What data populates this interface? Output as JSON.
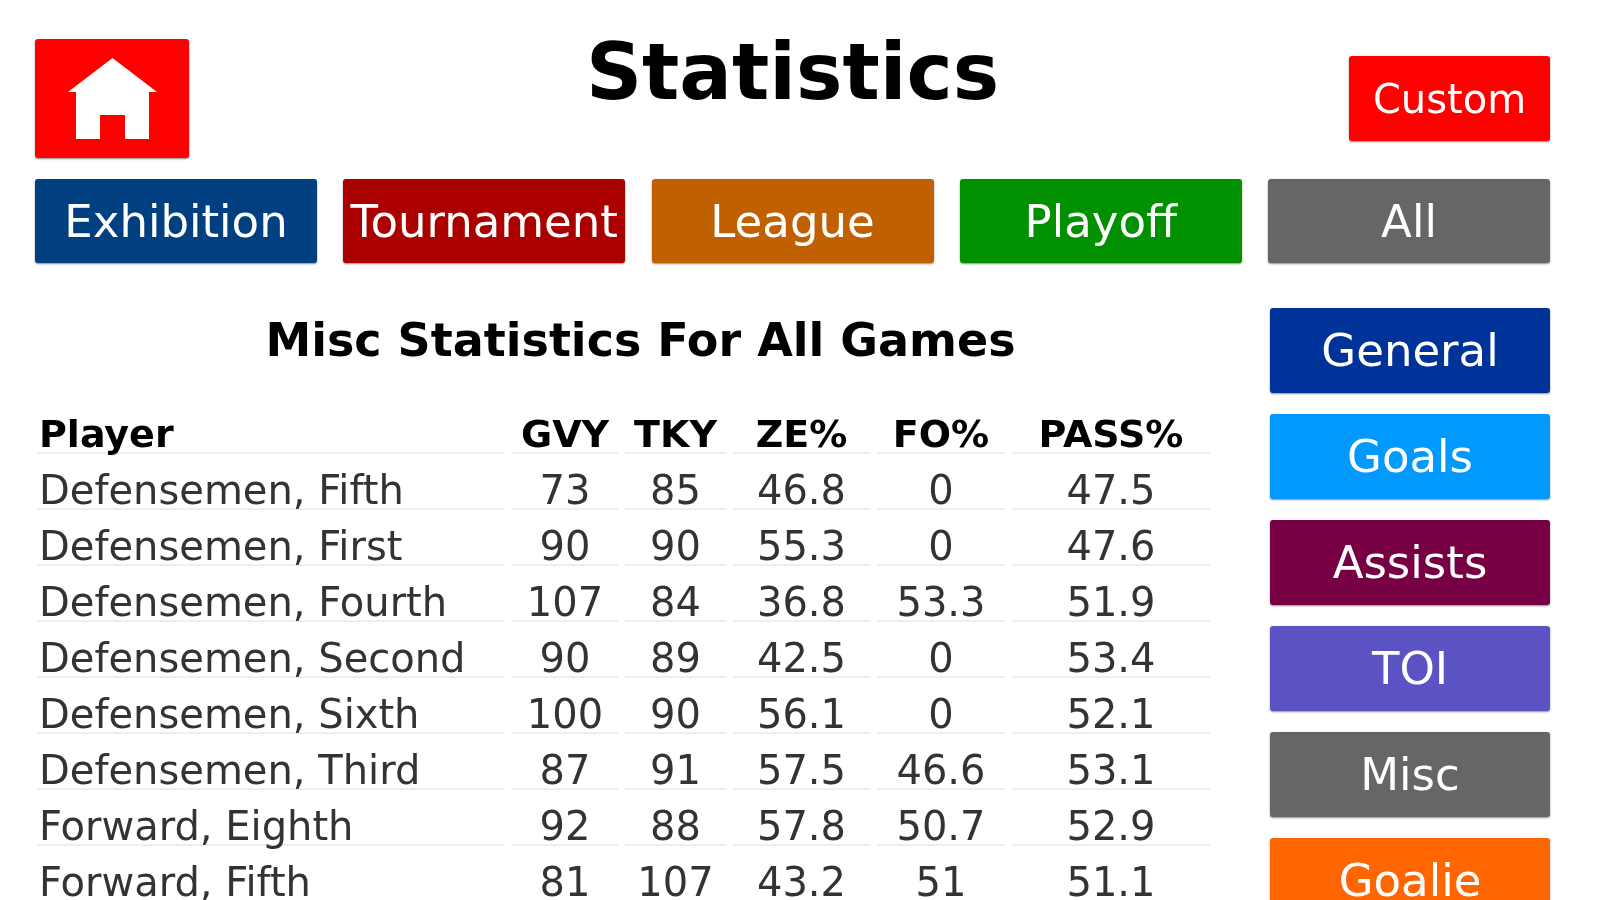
{
  "title": "Statistics",
  "custom_button": {
    "label": "Custom"
  },
  "game_types": [
    {
      "label": "Exhibition",
      "color": "#004080",
      "selected": false
    },
    {
      "label": "Tournament",
      "color": "#aa0000",
      "selected": false
    },
    {
      "label": "League",
      "color": "#c06000",
      "selected": false
    },
    {
      "label": "Playoff",
      "color": "#009000",
      "selected": false
    },
    {
      "label": "All",
      "selected": true
    }
  ],
  "subtitle": "Misc Statistics For All Games",
  "table": {
    "columns": [
      "Player",
      "GVY",
      "TKY",
      "ZE%",
      "FO%",
      "PASS%"
    ],
    "rows": [
      [
        "Defensemen, Fifth",
        "73",
        "85",
        "46.8",
        "0",
        "47.5"
      ],
      [
        "Defensemen, First",
        "90",
        "90",
        "55.3",
        "0",
        "47.6"
      ],
      [
        "Defensemen, Fourth",
        "107",
        "84",
        "36.8",
        "53.3",
        "51.9"
      ],
      [
        "Defensemen, Second",
        "90",
        "89",
        "42.5",
        "0",
        "53.4"
      ],
      [
        "Defensemen, Sixth",
        "100",
        "90",
        "56.1",
        "0",
        "52.1"
      ],
      [
        "Defensemen, Third",
        "87",
        "91",
        "57.5",
        "46.6",
        "53.1"
      ],
      [
        "Forward, Eighth",
        "92",
        "88",
        "57.8",
        "50.7",
        "52.9"
      ],
      [
        "Forward, Fifth",
        "81",
        "107",
        "43.2",
        "51",
        "51.1"
      ]
    ]
  },
  "stat_categories": [
    {
      "label": "General",
      "color": "#003399",
      "selected": false
    },
    {
      "label": "Goals",
      "color": "#0099ff",
      "selected": false
    },
    {
      "label": "Assists",
      "color": "#770044",
      "selected": false
    },
    {
      "label": "TOI",
      "color": "#5b52c4",
      "selected": false
    },
    {
      "label": "Misc",
      "selected": true
    },
    {
      "label": "Goalie",
      "color": "#ff6600",
      "selected": false
    }
  ]
}
